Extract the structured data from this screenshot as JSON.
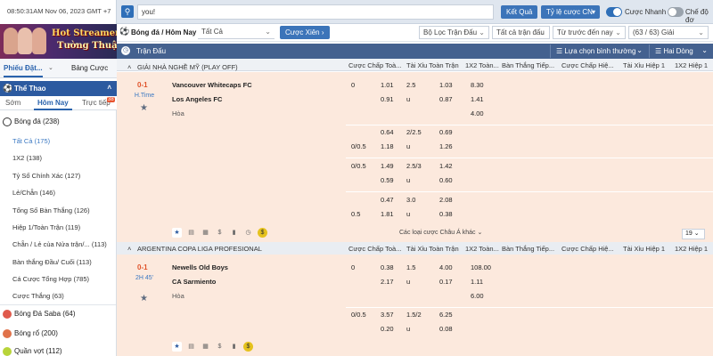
{
  "topbar": {
    "clock": "08:50:31AM Nov 06, 2023 GMT +7",
    "search_value": "you!",
    "result_button": "Kết Quả",
    "odds_button": "Tỷ lệ cược CN",
    "fast_bet_label": "Cược Nhanh",
    "simple_mode_label": "Chế độ đơ"
  },
  "banner": {
    "line1": "Hot Streamer",
    "line2": "Tường Thuật"
  },
  "left_tabs": {
    "bet_slip": "Phiếu Đặt...",
    "bet_table": "Bảng Cược"
  },
  "sport_header": "Thể Thao",
  "sub_tabs": {
    "early": "Sớm",
    "today": "Hôm Nay",
    "live": "Trực tiếp",
    "live_count": "38"
  },
  "sidebar": {
    "football": "Bóng đá",
    "football_count": "(238)",
    "items": [
      {
        "label": "Tất Cả",
        "count": "(175)"
      },
      {
        "label": "1X2",
        "count": "(138)"
      },
      {
        "label": "Tỷ Số Chính Xác",
        "count": "(127)"
      },
      {
        "label": "Lẻ/Chẵn",
        "count": "(146)"
      },
      {
        "label": "Tổng Số Bàn Thắng",
        "count": "(126)"
      },
      {
        "label": "Hiệp 1/Toàn Trận",
        "count": "(119)"
      },
      {
        "label": "Chẵn / Lẻ của Nửa trận/...",
        "count": "(113)"
      },
      {
        "label": "Bàn thắng Đầu/ Cuối",
        "count": "(113)"
      },
      {
        "label": "Cá Cược Tổng Hợp",
        "count": "(785)"
      },
      {
        "label": "Cược Thắng",
        "count": "(63)"
      }
    ],
    "saba": "Bóng Đá Saba",
    "saba_count": "(64)",
    "basketball": "Bóng rổ",
    "basketball_count": "(200)",
    "tennis": "Quần vợt",
    "tennis_count": "(112)"
  },
  "filterbar": {
    "title": "Bóng đá / Hôm Nay",
    "all_select": "Tất Cả",
    "parlay_button": "Cược Xiên",
    "filter_select": "Bộ Lọc Trận Đấu",
    "all_matches_select": "Tất cả trận đấu",
    "sort_select": "Từ trước đến nay",
    "count_select": "(63 / 63) Giải"
  },
  "match_header": {
    "label": "Trận Đấu",
    "sort_select": "Lựa chọn bình thường",
    "view_select": "Hai Dòng"
  },
  "columns": [
    "Cược Chấp Toà...",
    "Tài Xỉu Toàn Trận",
    "1X2 Toàn...",
    "Bàn Thắng Tiếp...",
    "Cược Chấp Hiệ...",
    "Tài Xỉu Hiệp 1",
    "1X2 Hiệp 1"
  ],
  "leagues": [
    {
      "name": "GIẢI NHÀ NGHỀ MỸ (PLAY OFF)",
      "score": "0-1",
      "status": "H.Time",
      "home": "Vancouver Whitecaps FC",
      "away": "Los Angeles FC",
      "draw": "Hòa",
      "rows": [
        {
          "hcap1": "0",
          "o1": "1.01",
          "hcap2": "",
          "o2": "0.91",
          "ou1": "2.5",
          "ou_o1": "1.03",
          "ou2": "u",
          "ou_o2": "0.87",
          "x1": "8.30",
          "x2": "1.41",
          "x3": "4.00"
        },
        {
          "hcap1": "",
          "o1": "0.64",
          "hcap2": "0/0.5",
          "o2": "1.18",
          "ou1": "2/2.5",
          "ou_o1": "0.69",
          "ou2": "u",
          "ou_o2": "1.26"
        },
        {
          "hcap1": "0/0.5",
          "o1": "1.49",
          "hcap2": "",
          "o2": "0.59",
          "ou1": "2.5/3",
          "ou_o1": "1.42",
          "ou2": "u",
          "ou_o2": "0.60"
        },
        {
          "hcap1": "",
          "o1": "0.47",
          "hcap2": "0.5",
          "o2": "1.81",
          "ou1": "3.0",
          "ou_o1": "2.08",
          "ou2": "u",
          "ou_o2": "0.38"
        }
      ],
      "more_text": "Các loại cược Châu Á khác",
      "page_value": "19"
    },
    {
      "name": "ARGENTINA COPA LIGA PROFESIONAL",
      "score": "0-1",
      "status": "2H 45'",
      "home": "Newells Old Boys",
      "away": "CA Sarmiento",
      "draw": "Hòa",
      "rows": [
        {
          "hcap1": "0",
          "o1": "0.38",
          "hcap2": "",
          "o2": "2.17",
          "ou1": "1.5",
          "ou_o1": "4.00",
          "ou2": "u",
          "ou_o2": "0.17",
          "x1": "108.00",
          "x2": "1.11",
          "x3": "6.00"
        },
        {
          "hcap1": "0/0.5",
          "o1": "3.57",
          "hcap2": "",
          "o2": "0.20",
          "ou1": "1.5/2",
          "ou_o1": "6.25",
          "ou2": "u",
          "ou_o2": "0.08"
        }
      ]
    }
  ],
  "colors": {
    "accent": "#2c5aa0",
    "row_bg": "#fce9dd",
    "score": "#e0532b"
  }
}
